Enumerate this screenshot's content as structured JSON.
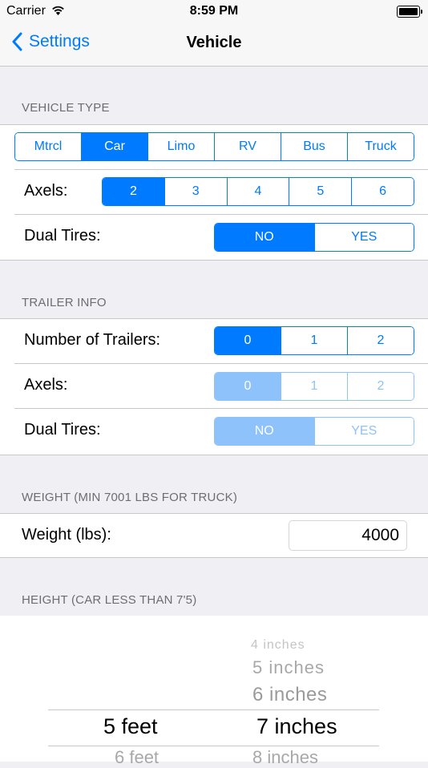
{
  "status_bar": {
    "carrier": "Carrier",
    "time": "8:59 PM"
  },
  "nav": {
    "back_label": "Settings",
    "title": "Vehicle"
  },
  "vehicle_type": {
    "header": "VEHICLE TYPE",
    "options": [
      "Mtrcl",
      "Car",
      "Limo",
      "RV",
      "Bus",
      "Truck"
    ],
    "selected": "Car",
    "axles_label": "Axels:",
    "axles_options": [
      "2",
      "3",
      "4",
      "5",
      "6"
    ],
    "axles_selected": "2",
    "dual_tires_label": "Dual Tires:",
    "dual_tires_options": [
      "NO",
      "YES"
    ],
    "dual_tires_selected": "NO"
  },
  "trailer_info": {
    "header": "TRAILER INFO",
    "trailers_label": "Number of Trailers:",
    "trailers_options": [
      "0",
      "1",
      "2"
    ],
    "trailers_selected": "0",
    "axles_label": "Axels:",
    "axles_options": [
      "0",
      "1",
      "2"
    ],
    "axles_selected": "0",
    "dual_tires_label": "Dual Tires:",
    "dual_tires_options": [
      "NO",
      "YES"
    ],
    "dual_tires_selected": "NO"
  },
  "weight": {
    "header": "WEIGHT (MIN 7001 LBS FOR TRUCK)",
    "label": "Weight (lbs):",
    "value": "4000"
  },
  "height": {
    "header": "HEIGHT (CAR LESS THAN 7'5)",
    "feet": {
      "selected": "5 feet",
      "below": "6 feet"
    },
    "inches": {
      "above_far": "4 inches",
      "above_2": "5 inches",
      "above_1": "6 inches",
      "selected": "7 inches",
      "below": "8 inches"
    }
  },
  "colors": {
    "accent": "#007aff",
    "accent_disabled": "#8ec2fb",
    "background": "#efeff4",
    "separator": "#c8c7cc"
  }
}
